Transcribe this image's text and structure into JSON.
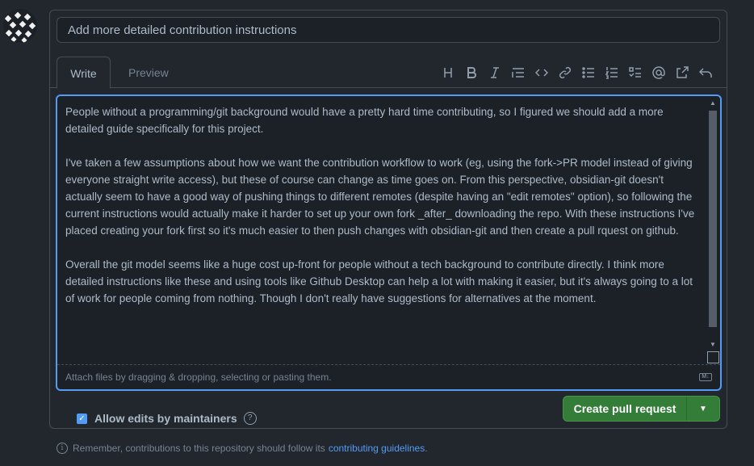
{
  "pr_form": {
    "title_value": "Add more detailed contribution instructions",
    "tabs": [
      {
        "label": "Write"
      },
      {
        "label": "Preview"
      }
    ],
    "toolbar": [
      "heading-icon",
      "bold-icon",
      "italic-icon",
      "quote-icon",
      "code-icon",
      "link-icon",
      "unordered-list-icon",
      "ordered-list-icon",
      "task-list-icon",
      "mention-icon",
      "reference-icon",
      "undo-icon"
    ],
    "body_text": "People without a programming/git background would have a pretty hard time contributing, so I figured we should add a more detailed guide specifically for this project.\n\nI've taken a few assumptions about how we want the contribution workflow to work (eg, using the fork->PR model instead of giving everyone straight write access), but these of course can change as time goes on. From this perspective, obsidian-git doesn't actually seem to have a good way of pushing things to different remotes (despite having an \"edit remotes\" option), so following the current instructions would actually make it harder to set up your own fork _after_ downloading the repo. With these instructions I've placed creating your fork first so it's much easier to then push changes with obsidian-git and then create a pull rquest on github.\n\nOverall the git model seems like a huge cost up-front for people without a tech background to contribute directly. I think more detailed instructions like these and using tools like Github Desktop can help a lot with making it easier, but it's always going to a lot of work for people coming from nothing. Though I don't really have suggestions for alternatives at the moment.",
    "attach_hint": "Attach files by dragging & dropping, selecting or pasting them.",
    "markdown_badge": "M↓",
    "allow_edits_label": "Allow edits by maintainers",
    "allow_edits_checked": true,
    "create_button_label": "Create pull request"
  },
  "footer": {
    "note": "Remember, contributions to this repository should follow its",
    "link": "contributing guidelines",
    "period": "."
  },
  "colors": {
    "background": "#22272e",
    "accent": "#539bf5",
    "create_button": "#347d39"
  }
}
